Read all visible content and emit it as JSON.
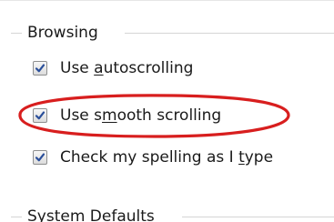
{
  "sections": {
    "browsing": {
      "title": "Browsing",
      "options": [
        {
          "pre": "Use ",
          "key": "a",
          "post": "utoscrolling",
          "checked": true
        },
        {
          "pre": "Use s",
          "key": "m",
          "post": "ooth scrolling",
          "checked": true,
          "highlighted": true
        },
        {
          "pre": "Check my spelling as I ",
          "key": "t",
          "post": "ype",
          "checked": true
        }
      ]
    },
    "system_defaults": {
      "title": "System Defaults"
    }
  },
  "colors": {
    "checkmark": "#2a4f9a",
    "highlight_ellipse": "#d81e1e",
    "group_rule": "#d5d5d5"
  },
  "icons": {
    "checkbox_checked": "checkmark-icon"
  }
}
